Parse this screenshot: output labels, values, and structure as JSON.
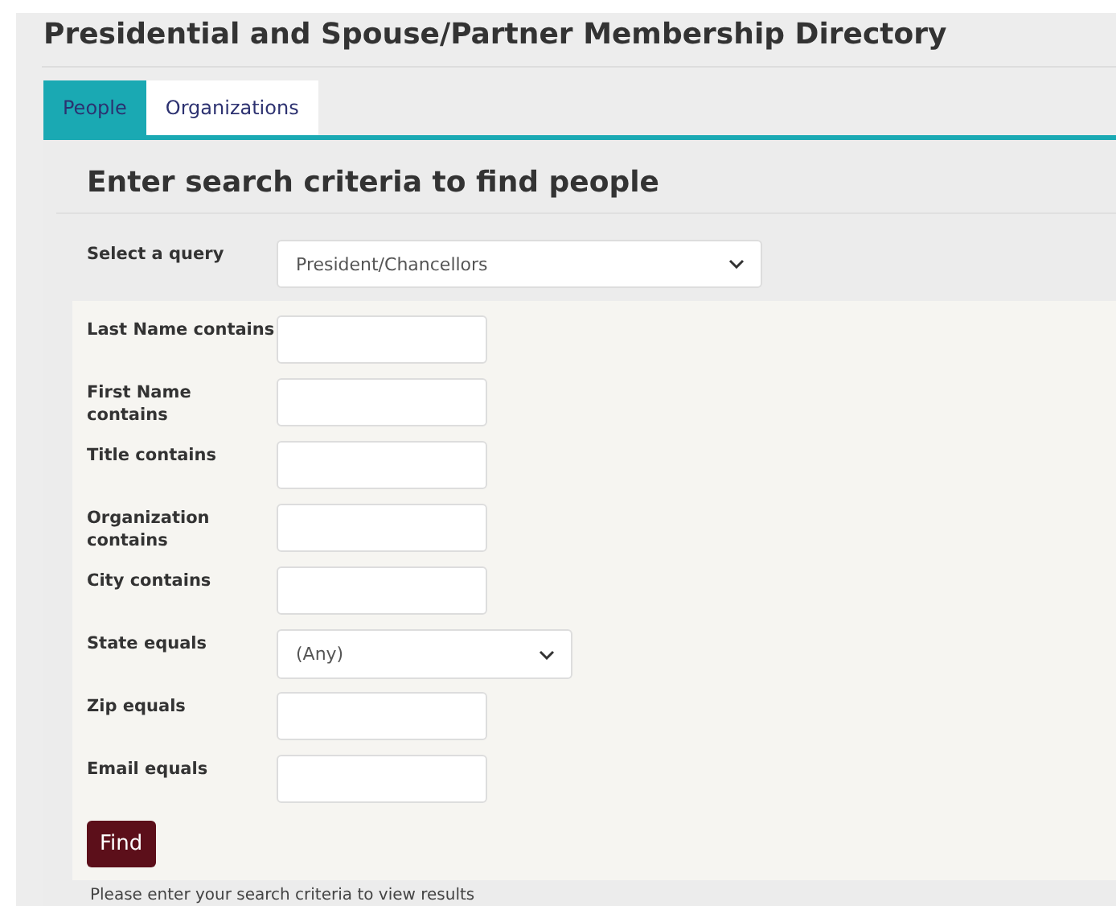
{
  "page": {
    "title": "Presidential and Spouse/Partner Membership Directory"
  },
  "tabs": [
    {
      "label": "People",
      "selected": true
    },
    {
      "label": "Organizations",
      "selected": false
    }
  ],
  "search": {
    "heading": "Enter search criteria to find people",
    "query": {
      "label": "Select a query",
      "value": "President/Chancellors"
    }
  },
  "fields": [
    {
      "kind": "text",
      "label": "Last Name contains"
    },
    {
      "kind": "text",
      "label": "First Name contains"
    },
    {
      "kind": "text",
      "label": "Title contains"
    },
    {
      "kind": "text",
      "label": "Organization contains"
    },
    {
      "kind": "text",
      "label": "City contains"
    },
    {
      "kind": "select",
      "label": "State equals",
      "value": "(Any)"
    },
    {
      "kind": "text",
      "label": "Zip equals"
    },
    {
      "kind": "text",
      "label": "Email equals"
    }
  ],
  "find_button": "Find",
  "status": "Please enter your search criteria to view results"
}
